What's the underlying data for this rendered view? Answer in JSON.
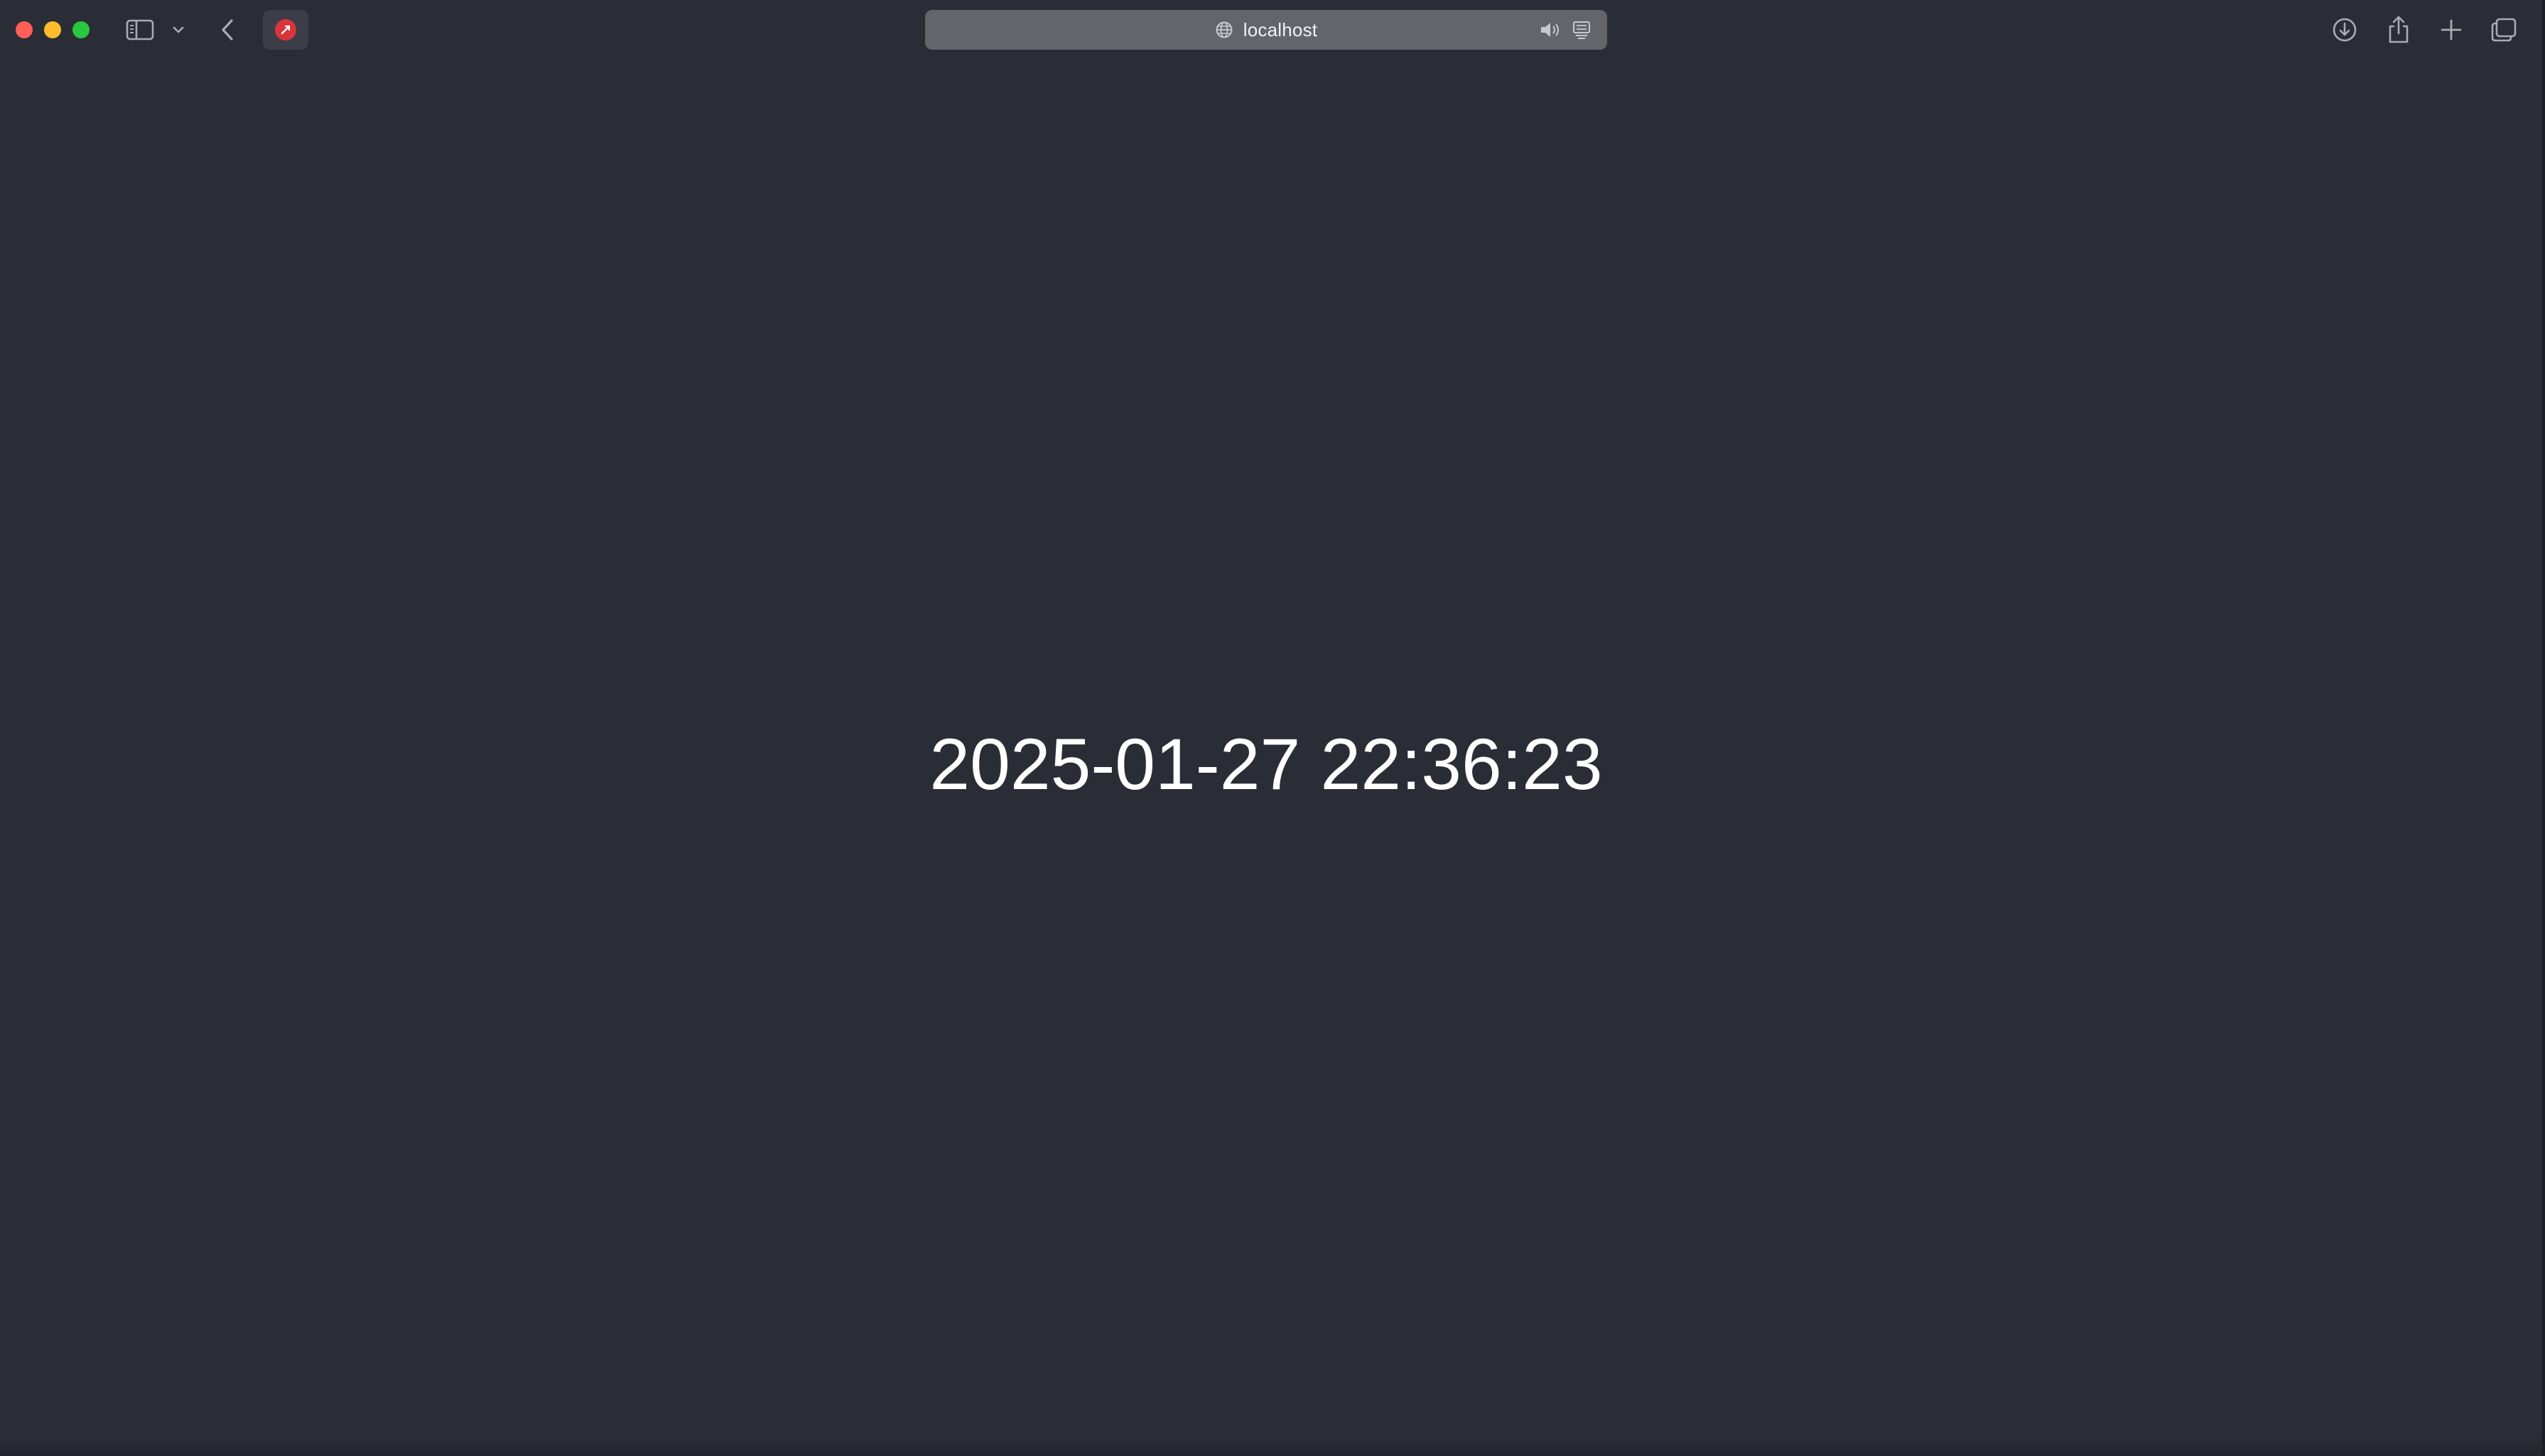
{
  "browser": {
    "address_bar": {
      "url": "localhost"
    },
    "icons": {
      "sidebar": "sidebar-icon",
      "chevron": "chevron-down-icon",
      "back": "back-arrow-icon",
      "extension": "extension-icon",
      "globe": "globe-icon",
      "audio": "speaker-icon",
      "reader": "reader-icon",
      "download": "download-icon",
      "share": "share-icon",
      "new_tab": "plus-icon",
      "tab_overview": "tabs-icon"
    },
    "colors": {
      "background": "#2a2d35",
      "urlbar": "#63656b",
      "close": "#ff5f57",
      "minimize": "#febc2e",
      "maximize": "#28c840",
      "extension": "#d9343b"
    }
  },
  "page": {
    "datetime": "2025-01-27 22:36:23"
  }
}
